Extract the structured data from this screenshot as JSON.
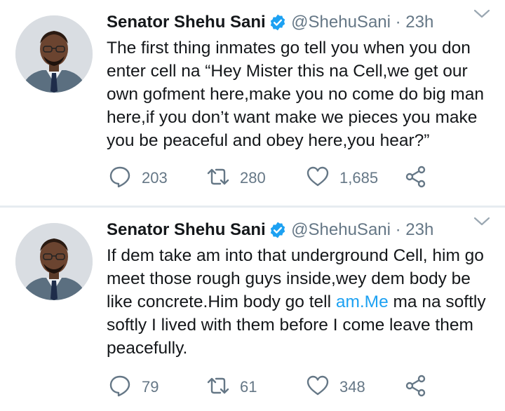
{
  "tweets": [
    {
      "name": "Senator Shehu Sani",
      "meta": "@ShehuSani · 23h",
      "text": "The first thing inmates go tell you when you don enter cell na “Hey Mister this na Cell,we get our own gofment here,make you no come do big man here,if you don’t want make we pieces you make you be peaceful and obey here,you hear?”",
      "replies": "203",
      "retweets": "280",
      "likes": "1,685"
    },
    {
      "name": "Senator Shehu Sani",
      "meta": "@ShehuSani · 23h",
      "text_before": "If dem take am into that underground Cell, him go meet those rough guys inside,wey dem body be like concrete.Him body go tell ",
      "link": "am.Me",
      "text_after": " ma na softly softly I lived with them before I come leave them peacefully.",
      "replies": "79",
      "retweets": "61",
      "likes": "348"
    }
  ],
  "icons": [
    "verified-badge-icon",
    "chevron-down-icon",
    "reply-icon",
    "retweet-icon",
    "heart-icon",
    "share-icon"
  ],
  "colors": {
    "accent": "#1da1f2",
    "muted": "#657786",
    "text": "#14171a",
    "divider": "#e6ecf0"
  }
}
